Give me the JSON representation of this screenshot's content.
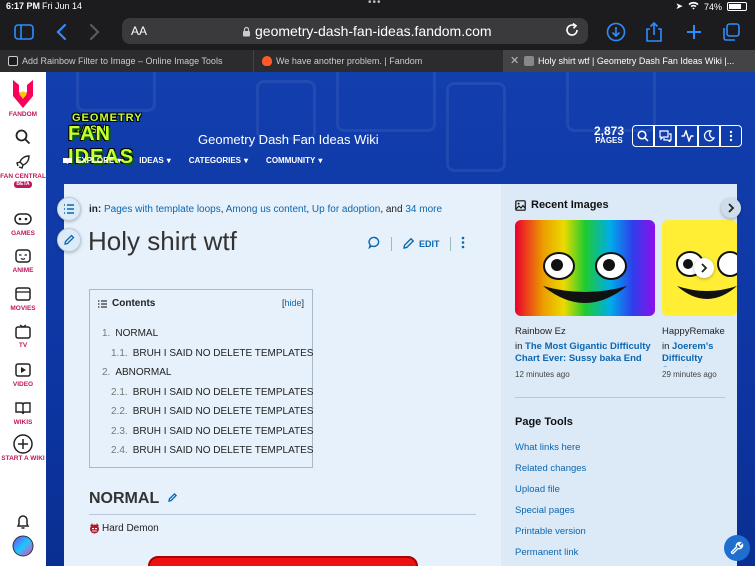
{
  "status_bar": {
    "time": "6:17 PM",
    "date": "Fri Jun 14",
    "battery": "74%",
    "battery_level": 0.74
  },
  "browser": {
    "aa_label": "AA",
    "url": "geometry-dash-fan-ideas.fandom.com",
    "tabs": [
      {
        "title": "Add Rainbow Filter to Image – Online Image Tools",
        "favicon_color": "#1c1c1e"
      },
      {
        "title": "We have another problem. | Fandom",
        "favicon_color": "#ff5a2a"
      },
      {
        "title": "Holy shirt wtf | Geometry Dash Fan Ideas Wiki |...",
        "favicon_color": "#888888",
        "active": true
      }
    ]
  },
  "rail": {
    "brand": "FANDOM",
    "items": [
      {
        "label": "FAN CENTRAL",
        "badge": "BETA",
        "icon": "rocket-icon"
      },
      {
        "label": "GAMES",
        "icon": "gamepad-icon"
      },
      {
        "label": "ANIME",
        "icon": "anime-icon"
      },
      {
        "label": "MOVIES",
        "icon": "movies-icon"
      },
      {
        "label": "TV",
        "icon": "tv-icon"
      },
      {
        "label": "VIDEO",
        "icon": "video-icon"
      },
      {
        "label": "WIKIS",
        "icon": "book-icon"
      },
      {
        "label": "START A WIKI",
        "icon": "plus-circle-icon"
      }
    ]
  },
  "wiki": {
    "logo_line1": "GEOMETRY DASH",
    "logo_line2": "FAN IDEAS",
    "title": "Geometry Dash Fan Ideas Wiki",
    "nav": [
      "EXPLORE",
      "IDEAS",
      "CATEGORIES",
      "COMMUNITY"
    ],
    "pages_count": "2,873",
    "pages_label": "PAGES"
  },
  "article": {
    "categories_prefix": "in:",
    "categories": [
      "Pages with template loops",
      "Among us content",
      "Up for adoption"
    ],
    "categories_and": ", and",
    "categories_more": "34 more",
    "title": "Holy shirt wtf",
    "edit_label": "EDIT",
    "toc": {
      "title": "Contents",
      "hide": "hide",
      "items": [
        {
          "num": "1.",
          "text": "NORMAL"
        },
        {
          "num": "1.1.",
          "text": "BRUH I SAID NO DELETE TEMPLATES"
        },
        {
          "num": "2.",
          "text": "ABNORMAL"
        },
        {
          "num": "2.1.",
          "text": "BRUH I SAID NO DELETE TEMPLATES"
        },
        {
          "num": "2.2.",
          "text": "BRUH I SAID NO DELETE TEMPLATES"
        },
        {
          "num": "2.3.",
          "text": "BRUH I SAID NO DELETE TEMPLATES"
        },
        {
          "num": "2.4.",
          "text": "BRUH I SAID NO DELETE TEMPLATES"
        }
      ]
    },
    "section_heading": "NORMAL",
    "difficulty": "Hard Demon"
  },
  "recent_images": {
    "title": "Recent Images",
    "items": [
      {
        "name": "Rainbow Ez",
        "in": "in",
        "link": "The Most Gigantic Difficulty Chart Ever: Sussy baka End",
        "time": "12 minutes ago"
      },
      {
        "name": "HappyRemake",
        "in": "in",
        "link": "Joerem's Difficulty Spectrum",
        "time": "29 minutes ago"
      }
    ]
  },
  "page_tools": {
    "title": "Page Tools",
    "links": [
      "What links here",
      "Related changes",
      "Upload file",
      "Special pages",
      "Printable version",
      "Permanent link"
    ]
  }
}
